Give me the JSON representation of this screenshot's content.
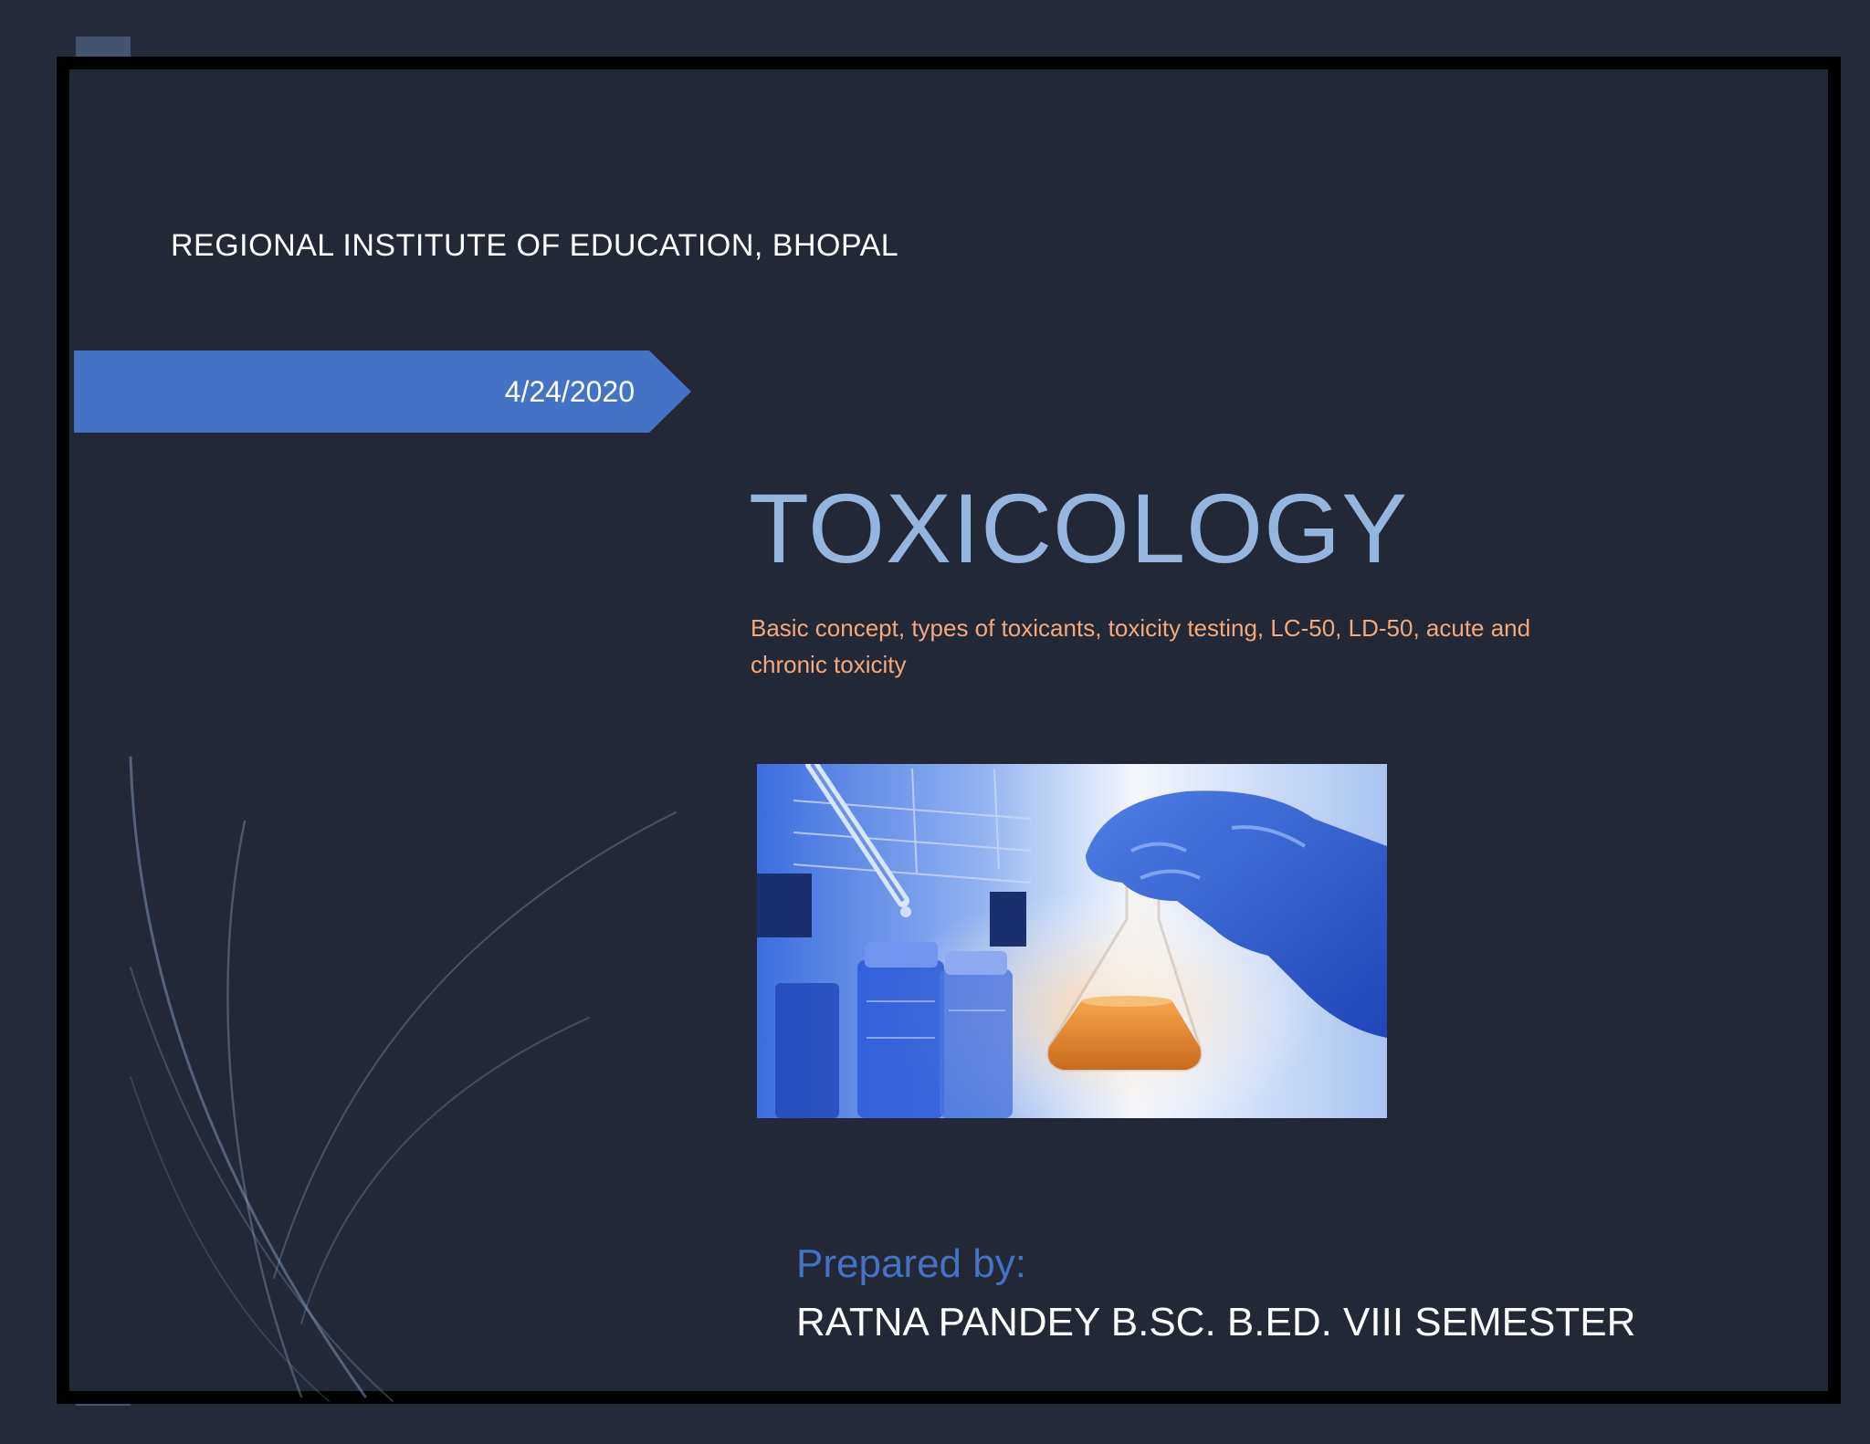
{
  "slide": {
    "institute": "REGIONAL INSTITUTE OF EDUCATION, BHOPAL",
    "date": "4/24/2020",
    "title": "TOXICOLOGY",
    "subtitle": "Basic concept, types of toxicants, toxicity testing, LC-50, LD-50, acute and chronic toxicity",
    "prepared_label": "Prepared by:",
    "author": "RATNA PANDEY B.SC. B.ED. VIII SEMESTER"
  },
  "colors": {
    "background": "#242a37",
    "frame": "#000000",
    "left_bar": "#44546e",
    "ribbon": "#4472c4",
    "title": "#93b5de",
    "subtitle": "#f1a980",
    "prepared_label": "#4472c4",
    "author": "#ffffff"
  }
}
